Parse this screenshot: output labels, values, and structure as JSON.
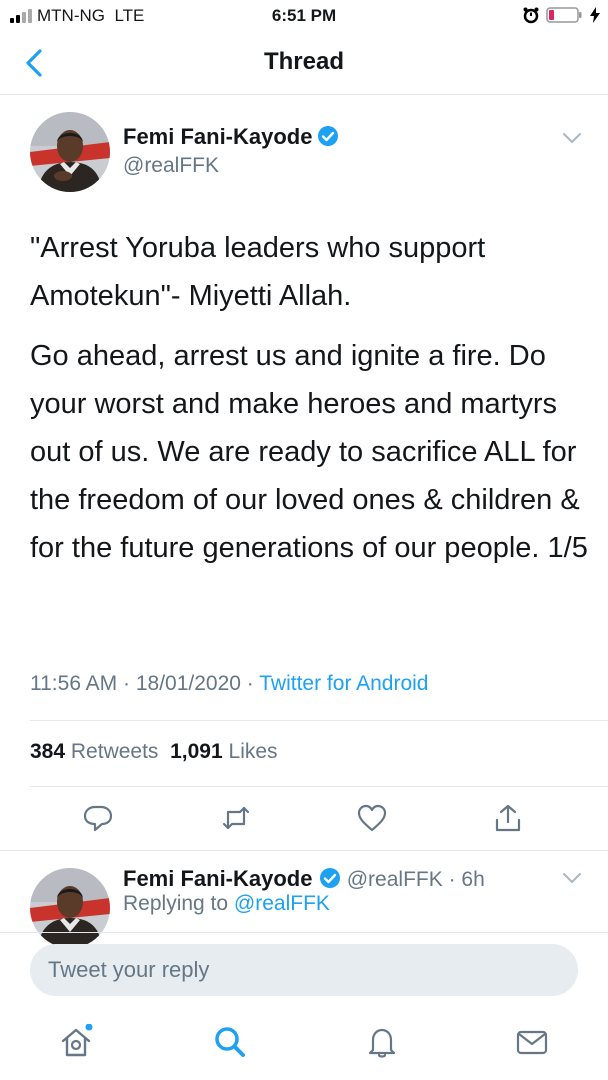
{
  "status_bar": {
    "carrier": "MTN-NG",
    "network": "LTE",
    "time": "6:51 PM"
  },
  "nav": {
    "title": "Thread"
  },
  "tweet": {
    "author_name": "Femi Fani-Kayode",
    "author_handle": "@realFFK",
    "paragraph1": "\"Arrest Yoruba leaders who support Amotekun\"- Miyetti Allah.",
    "paragraph2": "Go ahead, arrest us and ignite a fire. Do your worst and make heroes and martyrs out of us. We are ready to sacrifice ALL for the freedom of our loved ones & children & for the future generations of our people. 1/5",
    "time": "11:56 AM",
    "date": "18/01/2020",
    "source": "Twitter for Android",
    "retweet_count": "384",
    "retweet_label": "Retweets",
    "like_count": "1,091",
    "like_label": "Likes"
  },
  "reply_tweet": {
    "author_name": "Femi Fani-Kayode",
    "author_handle": "@realFFK",
    "age": "6h",
    "replying_prefix": "Replying to",
    "replying_to": "@realFFK"
  },
  "reply_box": {
    "placeholder": "Tweet your reply"
  },
  "colors": {
    "accent": "#1da1f2",
    "secondary_text": "#657786",
    "divider": "#e1e8ed"
  },
  "icons": [
    "back-icon",
    "verified-icon",
    "chevron-down-icon",
    "reply-icon",
    "retweet-icon",
    "like-icon",
    "share-icon",
    "home-icon",
    "search-icon",
    "notifications-icon",
    "messages-icon"
  ]
}
